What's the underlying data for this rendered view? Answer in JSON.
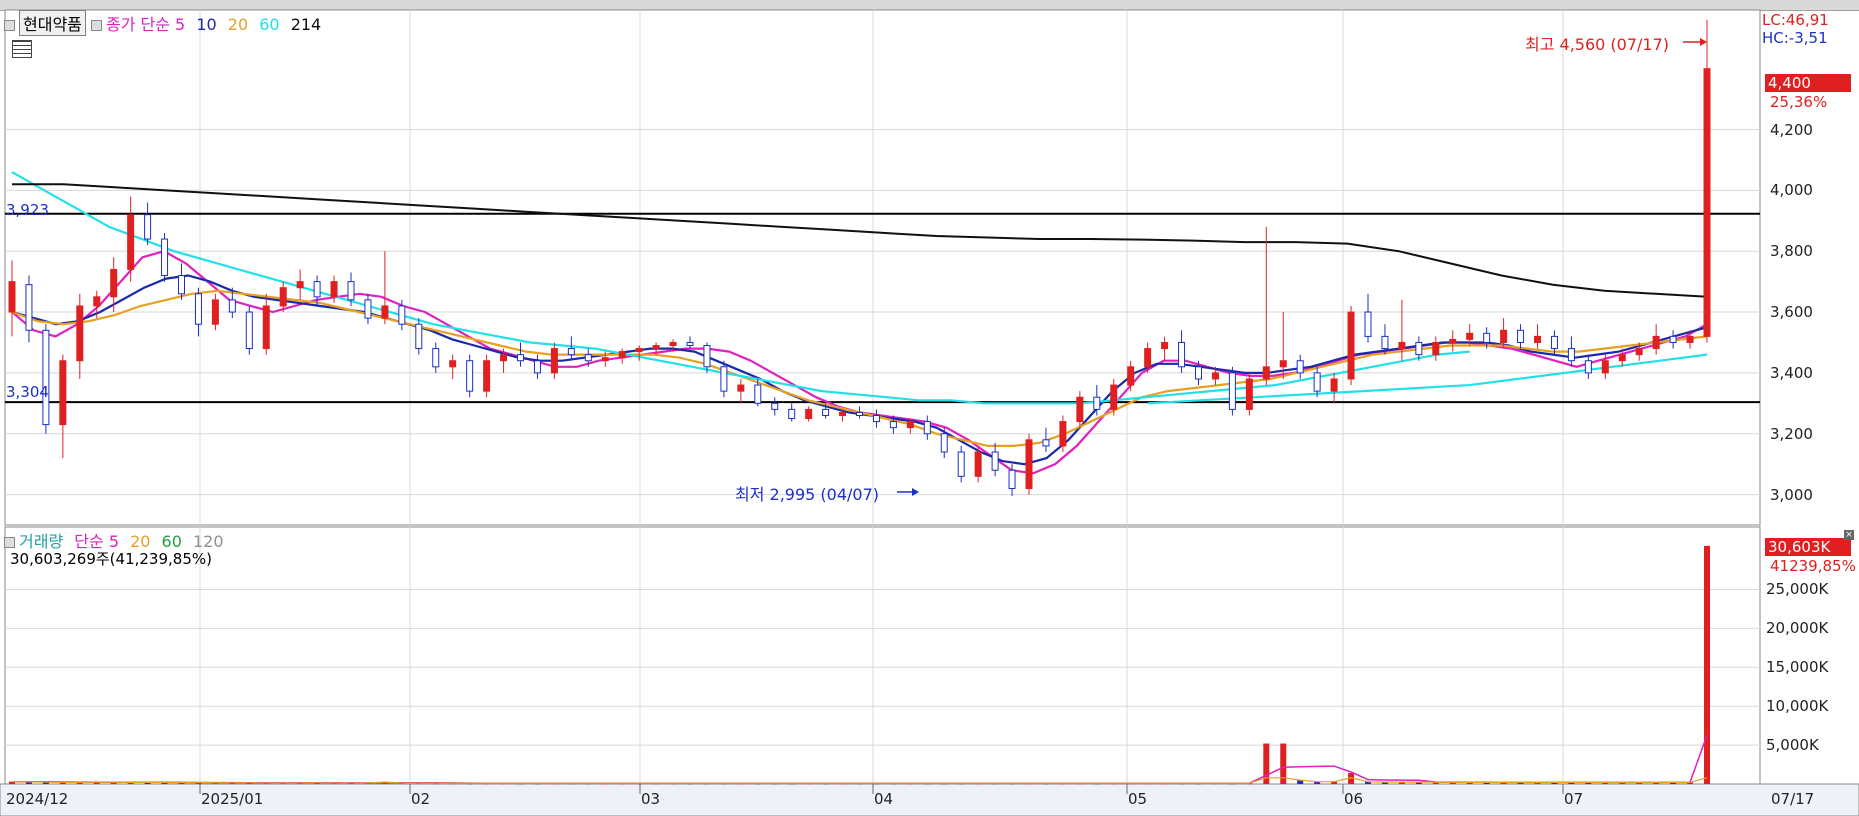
{
  "header": {
    "stock_name": "현대약품",
    "ma_label": "종가 단순",
    "ma_periods": [
      "5",
      "10",
      "20",
      "60",
      "214"
    ],
    "ma_colors": [
      "#e020c0",
      "#1a2aa8",
      "#e8a020",
      "#20e0e8",
      "#101010"
    ]
  },
  "volume_header": {
    "label": "거래량",
    "ma_label": "단순",
    "ma_periods": [
      "5",
      "20",
      "60",
      "120"
    ],
    "ma_colors": [
      "#e020c0",
      "#e8a020",
      "#20a040",
      "#909090"
    ],
    "total": "30,603,269주(41,239,85%)"
  },
  "indicators": {
    "lc": "LC:46,91",
    "hc": "HC:-3,51"
  },
  "price_tags": {
    "last": "4,400",
    "change": "25,36%"
  },
  "volume_tags": {
    "last": "30,603K",
    "change": "41239,85%"
  },
  "annotations": {
    "high": "최고 4,560 (07/17)",
    "low": "최저 2,995 (04/07)",
    "line_upper": "3,923",
    "line_lower": "3,304"
  },
  "colors": {
    "up": "#e02020",
    "down": "#1a30c8",
    "grid": "#d8d8d8",
    "axis_bg": "#ffffff"
  },
  "chart_data": {
    "type": "candlestick",
    "price_axis": {
      "ylim": [
        2900,
        4560
      ],
      "ticks": [
        "3,000",
        "3,200",
        "3,400",
        "3,600",
        "3,800",
        "4,000",
        "4,200"
      ]
    },
    "volume_axis": {
      "ylim": [
        0,
        32000
      ],
      "ticks": [
        "5,000K",
        "10,000K",
        "15,000K",
        "20,000K",
        "25,000K"
      ]
    },
    "x_labels": [
      "2024/12",
      "2025/01",
      "02",
      "03",
      "04",
      "05",
      "06",
      "07",
      "07/17"
    ],
    "horizontal_lines": [
      3923,
      3304
    ],
    "ohlc": [
      [
        3600,
        3770,
        3520,
        3700
      ],
      [
        3690,
        3720,
        3500,
        3540
      ],
      [
        3540,
        3560,
        3200,
        3230
      ],
      [
        3230,
        3460,
        3120,
        3440
      ],
      [
        3440,
        3660,
        3380,
        3620
      ],
      [
        3620,
        3670,
        3580,
        3650
      ],
      [
        3650,
        3780,
        3600,
        3740
      ],
      [
        3740,
        3980,
        3700,
        3920
      ],
      [
        3920,
        3960,
        3820,
        3840
      ],
      [
        3840,
        3860,
        3700,
        3720
      ],
      [
        3720,
        3760,
        3640,
        3660
      ],
      [
        3660,
        3680,
        3520,
        3560
      ],
      [
        3560,
        3660,
        3540,
        3640
      ],
      [
        3640,
        3680,
        3580,
        3600
      ],
      [
        3600,
        3620,
        3460,
        3480
      ],
      [
        3480,
        3660,
        3460,
        3620
      ],
      [
        3620,
        3700,
        3600,
        3680
      ],
      [
        3680,
        3740,
        3640,
        3700
      ],
      [
        3700,
        3720,
        3620,
        3650
      ],
      [
        3650,
        3720,
        3630,
        3700
      ],
      [
        3700,
        3730,
        3620,
        3640
      ],
      [
        3640,
        3660,
        3560,
        3580
      ],
      [
        3580,
        3800,
        3560,
        3620
      ],
      [
        3620,
        3640,
        3540,
        3560
      ],
      [
        3560,
        3580,
        3460,
        3480
      ],
      [
        3480,
        3500,
        3400,
        3420
      ],
      [
        3420,
        3460,
        3380,
        3440
      ],
      [
        3440,
        3460,
        3320,
        3340
      ],
      [
        3340,
        3460,
        3320,
        3440
      ],
      [
        3440,
        3480,
        3400,
        3460
      ],
      [
        3460,
        3500,
        3420,
        3440
      ],
      [
        3440,
        3460,
        3380,
        3400
      ],
      [
        3400,
        3500,
        3380,
        3480
      ],
      [
        3480,
        3520,
        3440,
        3460
      ],
      [
        3460,
        3480,
        3420,
        3440
      ],
      [
        3440,
        3470,
        3420,
        3450
      ],
      [
        3450,
        3480,
        3430,
        3470
      ],
      [
        3470,
        3490,
        3440,
        3480
      ],
      [
        3480,
        3500,
        3460,
        3490
      ],
      [
        3490,
        3510,
        3470,
        3500
      ],
      [
        3500,
        3520,
        3480,
        3490
      ],
      [
        3490,
        3500,
        3400,
        3420
      ],
      [
        3420,
        3440,
        3320,
        3340
      ],
      [
        3340,
        3380,
        3300,
        3360
      ],
      [
        3360,
        3380,
        3290,
        3300
      ],
      [
        3300,
        3320,
        3260,
        3280
      ],
      [
        3280,
        3300,
        3240,
        3250
      ],
      [
        3250,
        3290,
        3240,
        3280
      ],
      [
        3280,
        3300,
        3250,
        3260
      ],
      [
        3260,
        3280,
        3240,
        3270
      ],
      [
        3270,
        3290,
        3250,
        3260
      ],
      [
        3260,
        3280,
        3220,
        3240
      ],
      [
        3240,
        3260,
        3200,
        3220
      ],
      [
        3220,
        3250,
        3200,
        3240
      ],
      [
        3240,
        3260,
        3180,
        3200
      ],
      [
        3200,
        3220,
        3120,
        3140
      ],
      [
        3140,
        3160,
        3040,
        3060
      ],
      [
        3060,
        3160,
        3040,
        3140
      ],
      [
        3140,
        3170,
        3060,
        3080
      ],
      [
        3080,
        3100,
        2995,
        3020
      ],
      [
        3020,
        3200,
        3000,
        3180
      ],
      [
        3180,
        3220,
        3140,
        3160
      ],
      [
        3160,
        3260,
        3140,
        3240
      ],
      [
        3240,
        3340,
        3220,
        3320
      ],
      [
        3320,
        3360,
        3260,
        3280
      ],
      [
        3280,
        3380,
        3260,
        3360
      ],
      [
        3360,
        3440,
        3340,
        3420
      ],
      [
        3420,
        3500,
        3400,
        3480
      ],
      [
        3480,
        3520,
        3440,
        3500
      ],
      [
        3500,
        3540,
        3400,
        3420
      ],
      [
        3420,
        3440,
        3360,
        3380
      ],
      [
        3380,
        3420,
        3360,
        3400
      ],
      [
        3400,
        3420,
        3260,
        3280
      ],
      [
        3280,
        3400,
        3260,
        3380
      ],
      [
        3380,
        3880,
        3360,
        3420
      ],
      [
        3420,
        3600,
        3380,
        3440
      ],
      [
        3440,
        3460,
        3380,
        3400
      ],
      [
        3400,
        3420,
        3320,
        3340
      ],
      [
        3340,
        3400,
        3300,
        3380
      ],
      [
        3380,
        3620,
        3360,
        3600
      ],
      [
        3600,
        3660,
        3500,
        3520
      ],
      [
        3520,
        3560,
        3460,
        3480
      ],
      [
        3480,
        3640,
        3440,
        3500
      ],
      [
        3500,
        3520,
        3440,
        3460
      ],
      [
        3460,
        3520,
        3440,
        3500
      ],
      [
        3500,
        3540,
        3470,
        3510
      ],
      [
        3510,
        3560,
        3490,
        3530
      ],
      [
        3530,
        3550,
        3480,
        3500
      ],
      [
        3500,
        3580,
        3480,
        3540
      ],
      [
        3540,
        3560,
        3480,
        3500
      ],
      [
        3500,
        3560,
        3480,
        3520
      ],
      [
        3520,
        3540,
        3460,
        3480
      ],
      [
        3480,
        3520,
        3420,
        3440
      ],
      [
        3440,
        3460,
        3380,
        3400
      ],
      [
        3400,
        3460,
        3380,
        3440
      ],
      [
        3440,
        3480,
        3420,
        3460
      ],
      [
        3460,
        3500,
        3440,
        3480
      ],
      [
        3480,
        3560,
        3460,
        3520
      ],
      [
        3520,
        3540,
        3480,
        3500
      ],
      [
        3500,
        3540,
        3480,
        3520
      ],
      [
        3520,
        4560,
        3500,
        4400
      ]
    ],
    "ma_series": [
      {
        "name": "5",
        "color": "#e020c0",
        "values": [
          3600,
          3540,
          3520,
          3560,
          3620,
          3700,
          3780,
          3800,
          3760,
          3700,
          3640,
          3620,
          3600,
          3620,
          3640,
          3650,
          3660,
          3650,
          3620,
          3600,
          3560,
          3520,
          3480,
          3460,
          3440,
          3420,
          3420,
          3440,
          3450,
          3460,
          3470,
          3480,
          3480,
          3470,
          3440,
          3400,
          3360,
          3320,
          3290,
          3270,
          3260,
          3250,
          3240,
          3220,
          3180,
          3130,
          3080,
          3070,
          3100,
          3160,
          3240,
          3320,
          3400,
          3440,
          3440,
          3420,
          3400,
          3390,
          3390,
          3400,
          3420,
          3440,
          3460,
          3470,
          3480,
          3490,
          3500,
          3500,
          3490,
          3480,
          3460,
          3440,
          3420,
          3440,
          3460,
          3480,
          3500,
          3520,
          3560
        ]
      },
      {
        "name": "10",
        "color": "#1a2aa8",
        "values": [
          3600,
          3580,
          3560,
          3570,
          3600,
          3640,
          3680,
          3710,
          3720,
          3700,
          3670,
          3650,
          3640,
          3630,
          3620,
          3610,
          3600,
          3580,
          3560,
          3540,
          3510,
          3490,
          3470,
          3450,
          3440,
          3440,
          3450,
          3460,
          3470,
          3480,
          3480,
          3470,
          3440,
          3410,
          3380,
          3340,
          3310,
          3290,
          3270,
          3260,
          3250,
          3240,
          3220,
          3180,
          3140,
          3110,
          3100,
          3120,
          3180,
          3260,
          3340,
          3400,
          3430,
          3430,
          3420,
          3410,
          3400,
          3400,
          3410,
          3420,
          3440,
          3460,
          3470,
          3480,
          3490,
          3500,
          3500,
          3500,
          3490,
          3470,
          3460,
          3450,
          3460,
          3470,
          3490,
          3510,
          3530,
          3550
        ]
      },
      {
        "name": "20",
        "color": "#e8a020",
        "values": [
          3600,
          3570,
          3560,
          3570,
          3590,
          3620,
          3640,
          3660,
          3670,
          3660,
          3650,
          3640,
          3630,
          3610,
          3590,
          3570,
          3550,
          3530,
          3510,
          3490,
          3470,
          3460,
          3460,
          3460,
          3460,
          3460,
          3450,
          3430,
          3400,
          3370,
          3340,
          3310,
          3290,
          3270,
          3250,
          3230,
          3200,
          3180,
          3160,
          3160,
          3170,
          3200,
          3240,
          3280,
          3320,
          3340,
          3350,
          3360,
          3370,
          3380,
          3400,
          3420,
          3440,
          3460,
          3470,
          3480,
          3490,
          3490,
          3490,
          3480,
          3470,
          3470,
          3480,
          3490,
          3500,
          3510,
          3520
        ]
      },
      {
        "name": "60",
        "color": "#20e0e8",
        "values": [
          4060,
          4000,
          3940,
          3880,
          3840,
          3800,
          3770,
          3740,
          3710,
          3680,
          3650,
          3620,
          3590,
          3560,
          3540,
          3520,
          3500,
          3490,
          3480,
          3460,
          3440,
          3420,
          3400,
          3380,
          3360,
          3340,
          3330,
          3320,
          3310,
          3310,
          3300,
          3300,
          3300,
          3300,
          3310,
          3320,
          3330,
          3340,
          3350,
          3360,
          3380,
          3400,
          3420,
          3440,
          3460,
          3470
        ]
      },
      {
        "name": "214",
        "color": "#101010",
        "values": [
          4020,
          4020,
          4010,
          4000,
          3990,
          3980,
          3970,
          3960,
          3950,
          3940,
          3930,
          3920,
          3910,
          3900,
          3890,
          3880,
          3870,
          3860,
          3850,
          3845,
          3840,
          3840,
          3838,
          3835,
          3830,
          3830,
          3825,
          3800,
          3760,
          3720,
          3690,
          3670,
          3660,
          3650
        ]
      }
    ],
    "volume": [
      300,
      280,
      250,
      220,
      200,
      260,
      230,
      210,
      200,
      190,
      180,
      170,
      170,
      160,
      150,
      150,
      140,
      150,
      160,
      150,
      140,
      130,
      260,
      120,
      120,
      110,
      110,
      100,
      100,
      100,
      100,
      100,
      100,
      100,
      100,
      100,
      100,
      100,
      100,
      100,
      100,
      100,
      100,
      100,
      100,
      100,
      100,
      100,
      100,
      100,
      100,
      100,
      100,
      100,
      100,
      100,
      100,
      100,
      100,
      100,
      100,
      100,
      100,
      100,
      100,
      100,
      100,
      100,
      100,
      100,
      100,
      100,
      100,
      100,
      5200,
      5200,
      500,
      300,
      300,
      1400,
      300,
      250,
      250,
      250,
      250,
      200,
      200,
      200,
      200,
      200,
      200,
      200,
      200,
      200,
      200,
      200,
      200,
      200,
      200,
      200,
      30603
    ]
  }
}
